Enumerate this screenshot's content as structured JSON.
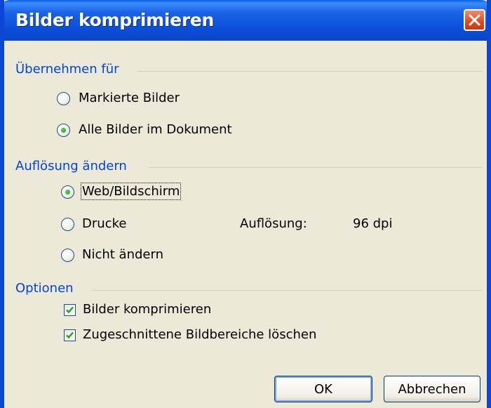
{
  "window": {
    "title": "Bilder komprimieren"
  },
  "groups": {
    "apply": {
      "label": "Übernehmen für",
      "options": [
        {
          "label": "Markierte Bilder",
          "selected": false
        },
        {
          "label": "Alle Bilder im Dokument",
          "selected": true
        }
      ]
    },
    "resolution": {
      "label": "Auflösung ändern",
      "options": [
        {
          "label": "Web/Bildschirm",
          "selected": true
        },
        {
          "label": "Drucke",
          "selected": false
        },
        {
          "label": "Nicht ändern",
          "selected": false
        }
      ],
      "value_label": "Auflösung:",
      "value": "96 dpi"
    },
    "options": {
      "label": "Optionen",
      "checkboxes": [
        {
          "label": "Bilder komprimieren",
          "checked": true
        },
        {
          "label": "Zugeschnittene Bildbereiche löschen",
          "checked": true
        }
      ]
    }
  },
  "buttons": {
    "ok": "OK",
    "cancel": "Abbrechen"
  },
  "colors": {
    "title_bar": "#0b46d4",
    "group_label": "#0046d5",
    "dialog_bg": "#ece9d8",
    "close_button": "#de4a1f"
  }
}
